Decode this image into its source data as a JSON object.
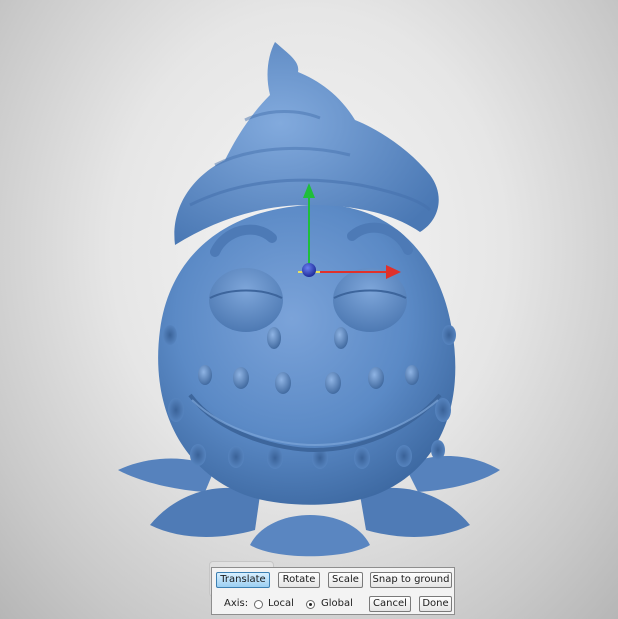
{
  "toolbar": {
    "translate_label": "Translate",
    "rotate_label": "Rotate",
    "scale_label": "Scale",
    "snap_label": "Snap to ground",
    "axis_label": "Axis:",
    "local_label": "Local",
    "global_label": "Global",
    "cancel_label": "Cancel",
    "done_label": "Done",
    "active_mode": "Translate",
    "selected_axis": "Global"
  },
  "gizmo": {
    "x_axis_color": "#e0312b",
    "y_axis_color": "#1fbf3a",
    "z_axis_color": "#2a3ec9",
    "center_icon": "blue-sphere"
  },
  "colors": {
    "model": "#5b8ac6",
    "background": "#e6e6e6"
  }
}
